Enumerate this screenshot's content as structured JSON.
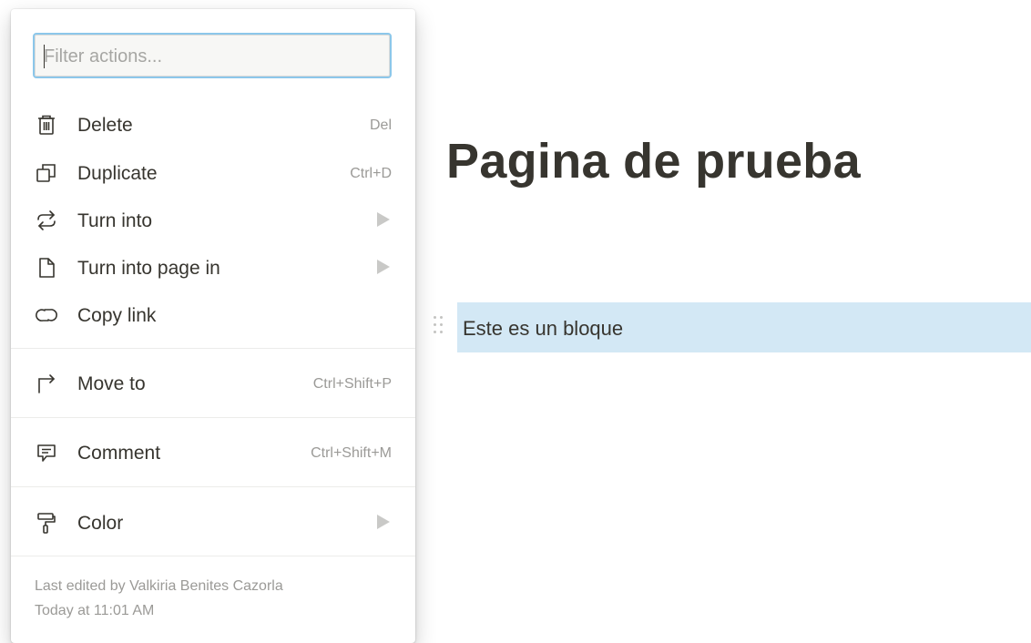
{
  "page": {
    "title": "Pagina de prueba",
    "block_text": "Este es un bloque"
  },
  "menu": {
    "filter_placeholder": "Filter actions...",
    "filter_value": "",
    "items": [
      {
        "label": "Delete",
        "shortcut": "Del",
        "icon": "trash-icon"
      },
      {
        "label": "Duplicate",
        "shortcut": "Ctrl+D",
        "icon": "duplicate-icon"
      },
      {
        "label": "Turn into",
        "shortcut": "",
        "icon": "turn-into-icon",
        "submenu": true
      },
      {
        "label": "Turn into page in",
        "shortcut": "",
        "icon": "page-icon",
        "submenu": true
      },
      {
        "label": "Copy link",
        "shortcut": "",
        "icon": "link-icon"
      },
      {
        "label": "Move to",
        "shortcut": "Ctrl+Shift+P",
        "icon": "move-to-icon"
      },
      {
        "label": "Comment",
        "shortcut": "Ctrl+Shift+M",
        "icon": "comment-icon"
      },
      {
        "label": "Color",
        "shortcut": "",
        "icon": "paint-roller-icon",
        "submenu": true
      }
    ],
    "footer": {
      "edited_by": "Last edited by Valkiria Benites Cazorla",
      "edited_at": "Today at 11:01 AM"
    }
  },
  "colors": {
    "selection": "#d3e8f5",
    "text": "#37352f",
    "muted": "#9b9a97",
    "focus_ring": "#8cc7ea"
  }
}
